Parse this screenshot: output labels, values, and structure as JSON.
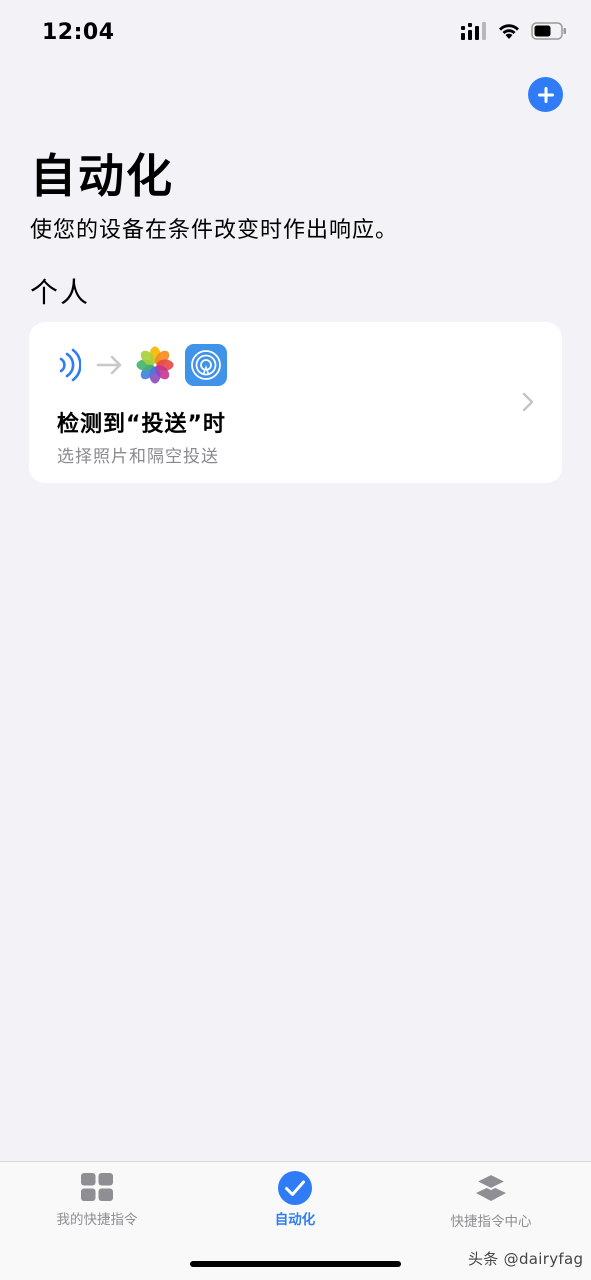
{
  "status_bar": {
    "time": "12:04",
    "icons": [
      "cellular-signal-icon",
      "wifi-icon",
      "battery-icon"
    ]
  },
  "header": {
    "add_button_icon": "plus-icon"
  },
  "main": {
    "title": "自动化",
    "subtitle": "使您的设备在条件改变时作出响应。",
    "sections": [
      {
        "header": "个人",
        "cards": [
          {
            "icons": [
              "nfc-waves-icon",
              "arrow-right-icon",
              "photos-app-icon",
              "airdrop-icon"
            ],
            "title": "检测到“投送”时",
            "subtitle": "选择照片和隔空投送"
          }
        ]
      }
    ]
  },
  "tab_bar": {
    "tabs": [
      {
        "label": "我的快捷指令",
        "icon": "grid-icon",
        "active": false
      },
      {
        "label": "自动化",
        "icon": "checkmark-circle-icon",
        "active": true
      },
      {
        "label": "快捷指令中心",
        "icon": "layers-icon",
        "active": false
      }
    ]
  },
  "watermark": "头条 @dairyfag",
  "colors": {
    "accent": "#2f7cf6",
    "background": "#f2f2f7",
    "card": "#ffffff",
    "secondary_text": "#8a8a8e",
    "tab_inactive": "#8e8e93"
  }
}
